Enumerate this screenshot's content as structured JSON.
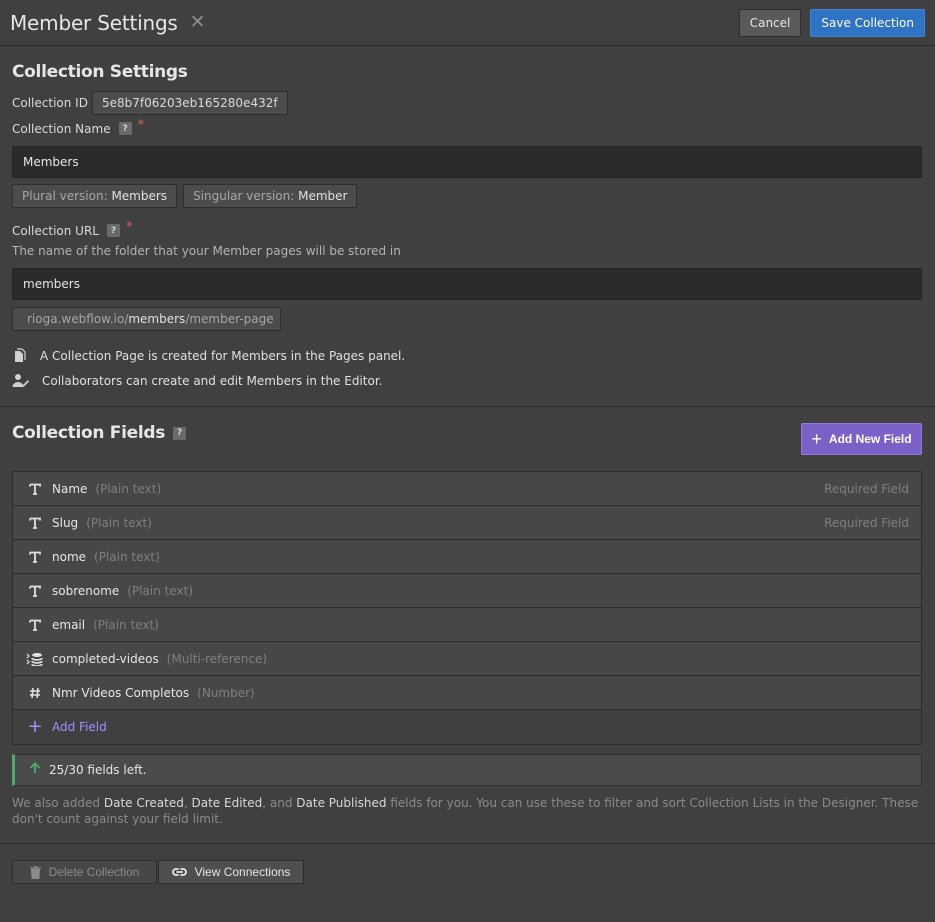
{
  "header": {
    "title": "Member Settings",
    "close_glyph": "✕",
    "cancel_label": "Cancel",
    "save_label": "Save Collection"
  },
  "settings": {
    "heading": "Collection Settings",
    "id_label": "Collection ID",
    "id_value": "5e8b7f06203eb165280e432f",
    "name_label": "Collection Name",
    "name_value": "Members",
    "plural_label": "Plural version:",
    "plural_value": "Members",
    "singular_label": "Singular version:",
    "singular_value": "Member",
    "url_label": "Collection URL",
    "url_hint": "The name of the folder that your Member pages will be stored in",
    "url_value": "members",
    "url_domain": "rioga.webflow.io/",
    "url_slug": "members",
    "url_suffix": "/member-page",
    "info_pages": "A Collection Page is created for Members in the Pages panel.",
    "info_editor": "Collaborators can create and edit Members in the Editor.",
    "help_glyph": "?",
    "required_glyph": "*"
  },
  "fields_section": {
    "heading": "Collection Fields",
    "add_new_label": "Add New Field",
    "add_field_label": "Add Field",
    "items": [
      {
        "icon": "text-icon",
        "name": "Name",
        "type": "(Plain text)",
        "required": "Required Field"
      },
      {
        "icon": "text-icon",
        "name": "Slug",
        "type": "(Plain text)",
        "required": "Required Field"
      },
      {
        "icon": "text-icon",
        "name": "nome",
        "type": "(Plain text)",
        "required": ""
      },
      {
        "icon": "text-icon",
        "name": "sobrenome",
        "type": "(Plain text)",
        "required": ""
      },
      {
        "icon": "text-icon",
        "name": "email",
        "type": "(Plain text)",
        "required": ""
      },
      {
        "icon": "multi-reference-icon",
        "name": "completed-videos",
        "type": "(Multi-reference)",
        "required": ""
      },
      {
        "icon": "number-icon",
        "name": "Nmr Videos Completos",
        "type": "(Number)",
        "required": ""
      }
    ],
    "fields_left": "25/30 fields left.",
    "note_1": "We also added ",
    "note_date_created": "Date Created",
    "note_2": ", ",
    "note_date_edited": "Date Edited",
    "note_3": ", and ",
    "note_date_published": "Date Published",
    "note_4": " fields for you. You can use these to filter and sort Collection Lists in the Designer. These don't count against your field limit."
  },
  "footer": {
    "delete_label": "Delete Collection",
    "view_label": "View Connections"
  },
  "colors": {
    "accent_blue": "#2f73c5",
    "accent_purple": "#7b61c7",
    "success_green": "#4caf6a",
    "required_red": "#e85a5a"
  }
}
